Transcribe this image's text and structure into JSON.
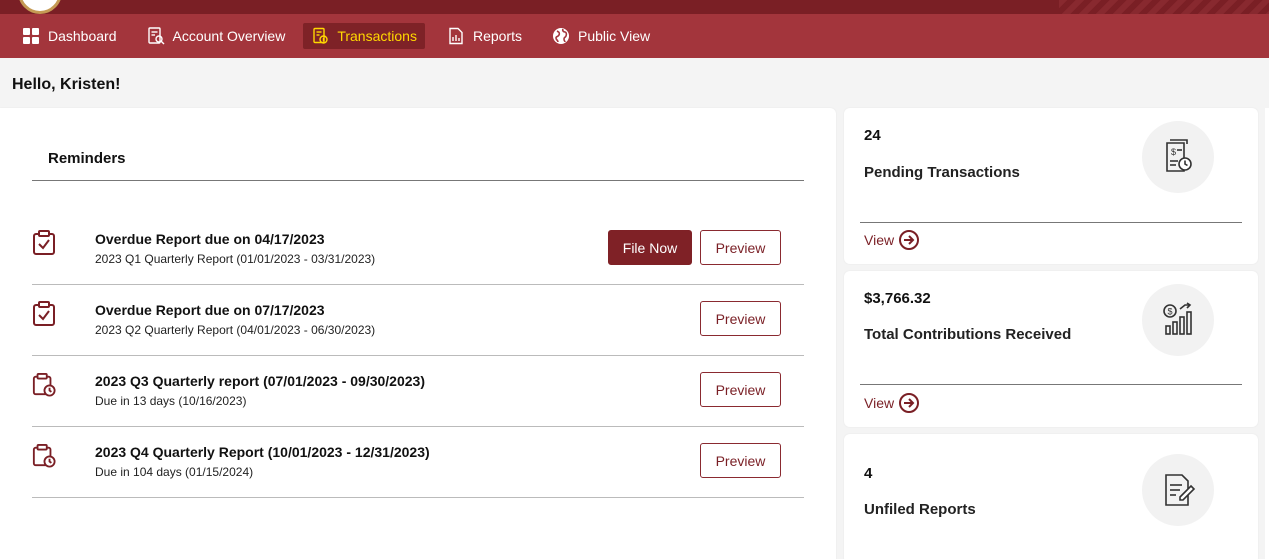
{
  "nav": {
    "items": [
      {
        "label": "Dashboard",
        "icon": "grid-icon"
      },
      {
        "label": "Account Overview",
        "icon": "account-search-icon"
      },
      {
        "label": "Transactions",
        "icon": "transactions-icon",
        "active": true
      },
      {
        "label": "Reports",
        "icon": "report-icon"
      },
      {
        "label": "Public View",
        "icon": "globe-icon"
      }
    ]
  },
  "greeting": "Hello, Kristen!",
  "reminders": {
    "title": "Reminders",
    "items": [
      {
        "title": "Overdue Report due on 04/17/2023",
        "subtitle": "2023 Q1 Quarterly Report (01/01/2023 - 03/31/2023)",
        "icon": "clipboard-check-icon",
        "file_now": "File Now",
        "preview": "Preview"
      },
      {
        "title": "Overdue Report due on 07/17/2023",
        "subtitle": "2023 Q2 Quarterly Report (04/01/2023 - 06/30/2023)",
        "icon": "clipboard-check-icon",
        "preview": "Preview"
      },
      {
        "title": "2023 Q3 Quarterly report (07/01/2023 - 09/30/2023)",
        "subtitle": "Due in 13 days (10/16/2023)",
        "icon": "clipboard-clock-icon",
        "preview": "Preview"
      },
      {
        "title": "2023 Q4 Quarterly Report (10/01/2023 - 12/31/2023)",
        "subtitle": "Due in 104 days (01/15/2024)",
        "icon": "clipboard-clock-icon",
        "preview": "Preview"
      }
    ]
  },
  "stats": [
    {
      "value": "24",
      "label": "Pending Transactions",
      "link": "View",
      "icon": "document-dollar-clock-icon"
    },
    {
      "value": "$3,766.32",
      "label": "Total Contributions Received",
      "link": "View",
      "icon": "dollar-chart-icon"
    },
    {
      "value": "4",
      "label": "Unfiled Reports",
      "link": "",
      "icon": "document-edit-icon"
    }
  ],
  "colors": {
    "brand": "#a3353c",
    "brand_dark": "#7f2126",
    "active_text": "#ffd800"
  }
}
